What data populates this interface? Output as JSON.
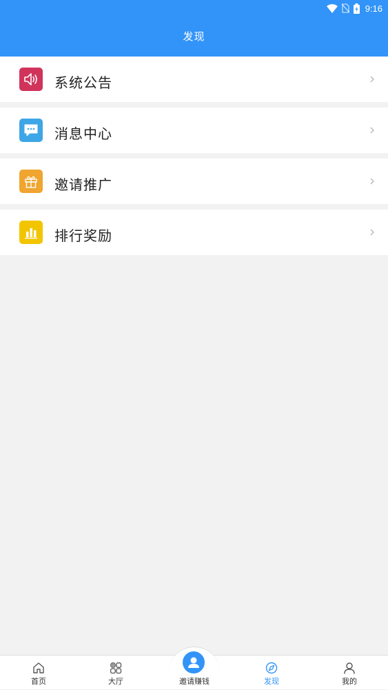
{
  "status_bar": {
    "time": "9:16",
    "icons": [
      "wifi-icon",
      "no-sim-icon",
      "battery-charging-icon"
    ]
  },
  "header": {
    "title": "发现",
    "background_color": "#3294f8"
  },
  "menu": {
    "items": [
      {
        "label": "系统公告",
        "icon": "speaker-icon",
        "color": "#d0345b"
      },
      {
        "label": "消息中心",
        "icon": "chat-bubble-icon",
        "color": "#3ea6e6"
      },
      {
        "label": "邀请推广",
        "icon": "gift-icon",
        "color": "#f0a530"
      },
      {
        "label": "排行奖励",
        "icon": "bar-chart-icon",
        "color": "#f2c500"
      }
    ]
  },
  "bottom_nav": {
    "active_color": "#3294f8",
    "items": [
      {
        "label": "首页",
        "icon": "home-icon"
      },
      {
        "label": "大厅",
        "icon": "grid-icon"
      },
      {
        "label": "邀请赚钱",
        "icon": "user-icon"
      },
      {
        "label": "发现",
        "icon": "compass-icon",
        "active": true
      },
      {
        "label": "我的",
        "icon": "person-icon"
      }
    ]
  }
}
